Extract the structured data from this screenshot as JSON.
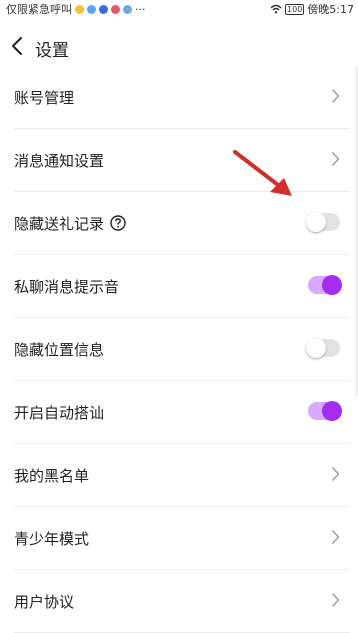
{
  "status_bar": {
    "left_text": "仅限紧急呼叫",
    "battery": "100",
    "right_text": "傍晚5:17",
    "more": "···"
  },
  "header": {
    "title": "设置"
  },
  "settings": {
    "account": {
      "label": "账号管理"
    },
    "notifications": {
      "label": "消息通知设置"
    },
    "hide_gift_records": {
      "label": "隐藏送礼记录",
      "enabled": false
    },
    "private_chat_sound": {
      "label": "私聊消息提示音",
      "enabled": true
    },
    "hide_location": {
      "label": "隐藏位置信息",
      "enabled": false
    },
    "auto_chat": {
      "label": "开启自动搭讪",
      "enabled": true
    },
    "blacklist": {
      "label": "我的黑名单"
    },
    "teen_mode": {
      "label": "青少年模式"
    },
    "user_agreement": {
      "label": "用户协议"
    }
  },
  "colors": {
    "accent": "#a52cf0",
    "toggle_on_track": "#d9a8ff",
    "toggle_off_track": "#e3e3e3",
    "annotation_arrow": "#d0302a"
  }
}
